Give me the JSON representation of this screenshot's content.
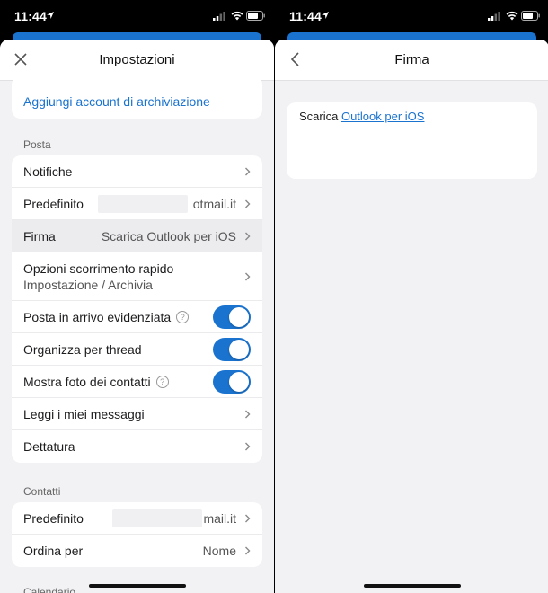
{
  "status": {
    "time": "11:44"
  },
  "left": {
    "nav_title": "Impostazioni",
    "add_storage": "Aggiungi account di archiviazione",
    "sections": {
      "posta": "Posta",
      "contatti": "Contatti",
      "calendario": "Calendario"
    },
    "posta_rows": {
      "notifiche": "Notifiche",
      "predefinito_label": "Predefinito",
      "predefinito_value": "otmail.it",
      "firma_label": "Firma",
      "firma_value": "Scarica Outlook per iOS",
      "swipe_label": "Opzioni scorrimento rapido",
      "swipe_sub": "Impostazione / Archivia",
      "focused_label": "Posta in arrivo evidenziata",
      "thread_label": "Organizza per thread",
      "photos_label": "Mostra foto dei contatti",
      "leggi_label": "Leggi i miei messaggi",
      "dettatura_label": "Dettatura"
    },
    "contatti_rows": {
      "predefinito_label": "Predefinito",
      "predefinito_value": "mail.it",
      "ordina_label": "Ordina per",
      "ordina_value": "Nome"
    },
    "toggles": {
      "focused": true,
      "thread": true,
      "photos": true
    }
  },
  "right": {
    "nav_title": "Firma",
    "signature_prefix": "Scarica ",
    "signature_link": "Outlook per iOS"
  },
  "colors": {
    "accent": "#1a73cf",
    "background": "#f2f2f4"
  }
}
